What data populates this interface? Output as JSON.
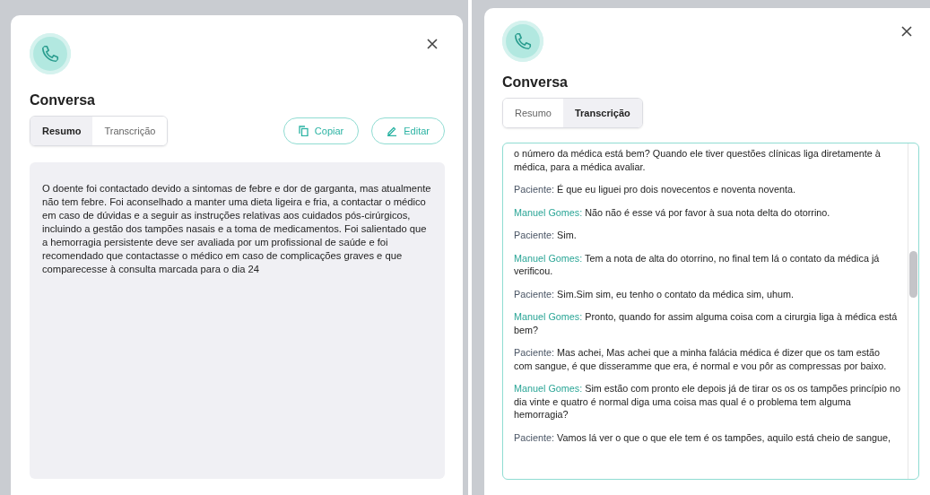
{
  "dialogs": [
    {
      "title": "Conversa",
      "tabs": [
        {
          "label": "Resumo",
          "selected": true
        },
        {
          "label": "Transcrição",
          "selected": false
        }
      ],
      "actions": [
        {
          "label": "Copiar",
          "kind": "copy"
        },
        {
          "label": "Editar",
          "kind": "edit"
        }
      ],
      "summary": "O doente foi contactado devido a sintomas de febre e dor de garganta, mas atualmente não tem febre. Foi aconselhado a manter uma dieta ligeira e fria, a contactar o médico em caso de dúvidas e a seguir as instruções relativas aos cuidados pós-cirúrgicos, incluindo a gestão dos tampões nasais e a toma de medicamentos. Foi salientado que a hemorragia persistente deve ser avaliada por um profissional de saúde e foi recomendado que contactasse o médico em caso de complicações graves e que comparecesse à consulta marcada para o dia 24"
    },
    {
      "title": "Conversa",
      "tabs": [
        {
          "label": "Resumo",
          "selected": false
        },
        {
          "label": "Transcrição",
          "selected": true
        }
      ],
      "transcript": [
        {
          "text": "o número da médica está bem? Quando ele tiver questões clínicas liga diretamente à médica, para a médica avaliar."
        },
        {
          "kind": "patient",
          "speaker": "Paciente:",
          "text": "É que eu liguei pro dois novecentos e noventa noventa."
        },
        {
          "kind": "staff",
          "speaker": "Manuel Gomes:",
          "text": "Não não é esse vá por favor à sua nota delta do otorrino."
        },
        {
          "kind": "patient",
          "speaker": "Paciente:",
          "text": "Sim."
        },
        {
          "kind": "staff",
          "speaker": "Manuel Gomes:",
          "text": "Tem a nota de alta do otorrino, no final tem lá o contato da médica já verificou."
        },
        {
          "kind": "patient",
          "speaker": "Paciente:",
          "text": "Sim.Sim sim, eu tenho o contato da médica sim, uhum."
        },
        {
          "kind": "staff",
          "speaker": "Manuel Gomes:",
          "text": "Pronto, quando for assim alguma coisa com a cirurgia liga à médica está bem?"
        },
        {
          "kind": "patient",
          "speaker": "Paciente:",
          "text": "Mas achei, Mas achei que a minha falácia médica é dizer que os tam estão com sangue, é que disseramme que era, é normal e vou pôr as compressas por baixo."
        },
        {
          "kind": "staff",
          "speaker": "Manuel Gomes:",
          "text": "Sim estão com pronto ele depois já de tirar os os os tampões princípio no dia vinte e quatro é normal diga uma coisa mas qual é o problema tem alguma hemorragia?"
        },
        {
          "kind": "patient",
          "speaker": "Paciente:",
          "text": "Vamos lá ver o que o que ele tem é os tampões, aquilo está cheio de sangue,"
        }
      ]
    }
  ]
}
